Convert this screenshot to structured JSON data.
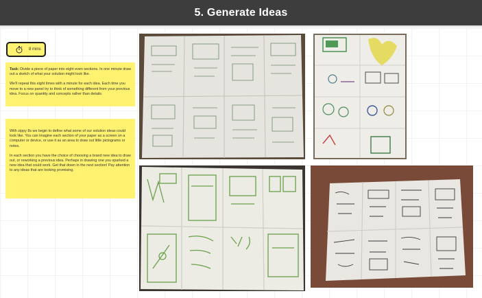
{
  "header": {
    "title": "5. Generate Ideas"
  },
  "timer": {
    "label": "8 mins",
    "icon": "stopwatch-icon"
  },
  "notes": {
    "task_label": "Task:",
    "task_text": " Divide a piece of paper into eight even sections. In one minute draw out a sketch of what your solution might look like.",
    "repeat_text": "We'll repeat this eight times with a minute for each idea. Each time you move to a new panel try to think of something different from your previous idea. Focus on quantity and concepts rather than details.",
    "zippy_text": "With zippy 8s we begin to define what some of our solution ideas could look like. You can imagine each section of your paper as a screen on a computer or device, or use it as an area to draw out little pictograms or notes.",
    "choice_text": "In each section you have the choice of choosing a brand new idea to draw out, or reworking a previous idea. Perhaps in drawing one you sparked a new idea that could work. Get that down in the next section! Pay attention to any ideas that are looking promising."
  },
  "colors": {
    "header_bg": "#3d3d3d",
    "note_yellow": "#fff271",
    "timer_border": "#1a1a1a"
  }
}
